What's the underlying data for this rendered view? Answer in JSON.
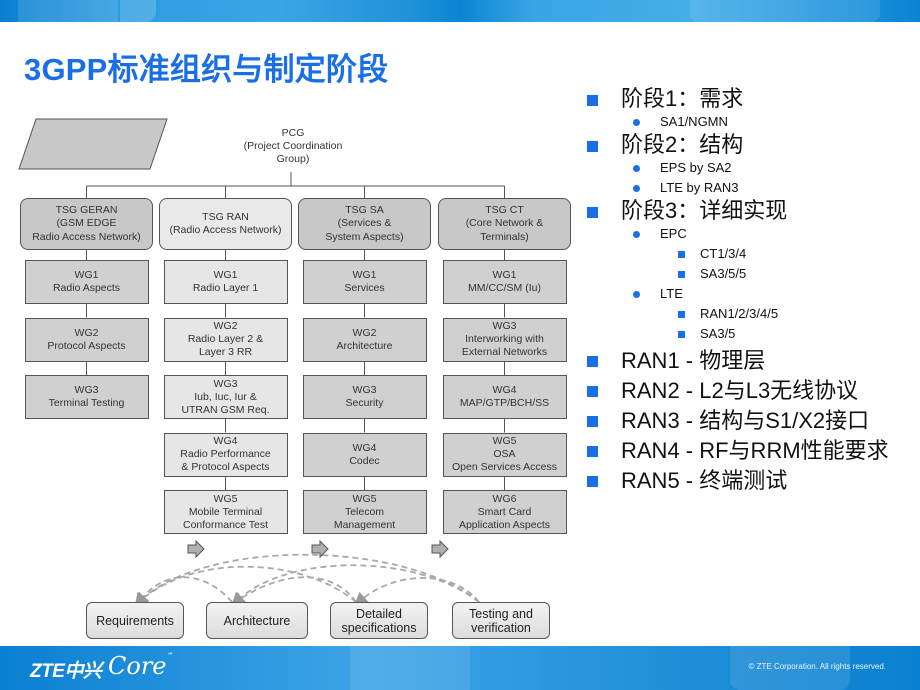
{
  "slide": {
    "title": "3GPP标准组织与制定阶段",
    "accent_color": "#1a6fe6"
  },
  "org_chart": {
    "root": {
      "lines": [
        "PCG",
        "(Project Coordination",
        "Group)"
      ]
    },
    "tsgs": [
      {
        "label": "TSG GERAN\n(GSM EDGE\nRadio Access Network)",
        "shade": "dark",
        "wgs": [
          "WG1\nRadio Aspects",
          "WG2\nProtocol Aspects",
          "WG3\nTerminal Testing"
        ]
      },
      {
        "label": "TSG RAN\n(Radio Access Network)",
        "shade": "light",
        "wgs": [
          "WG1\nRadio Layer 1",
          "WG2\nRadio Layer 2 &\nLayer 3 RR",
          "WG3\nIub, Iuc, Iur &\nUTRAN GSM Req.",
          "WG4\nRadio Performance\n& Protocol Aspects",
          "WG5\nMobile Terminal\nConformance Test"
        ]
      },
      {
        "label": "TSG SA\n(Services &\nSystem Aspects)",
        "shade": "dark",
        "wgs": [
          "WG1\nServices",
          "WG2\nArchitecture",
          "WG3\nSecurity",
          "WG4\nCodec",
          "WG5\nTelecom\nManagement"
        ]
      },
      {
        "label": "TSG CT\n(Core Network &\nTerminals)",
        "shade": "dark",
        "wgs": [
          "WG1\nMM/CC/SM (Iu)",
          "WG3\nInterworking with\nExternal Networks",
          "WG4\nMAP/GTP/BCH/SS",
          "WG5\nOSA\nOpen Services Access",
          "WG6\nSmart Card\nApplication Aspects"
        ]
      }
    ]
  },
  "process_flow": {
    "steps": [
      "Requirements",
      "Architecture",
      "Detailed\nspecifications",
      "Testing and\nverification"
    ]
  },
  "bullets": {
    "stages": [
      {
        "label": "阶段1：需求",
        "items": [
          {
            "label": "SA1/NGMN",
            "sub": []
          }
        ]
      },
      {
        "label": "阶段2：结构",
        "items": [
          {
            "label": "EPS by SA2",
            "sub": []
          },
          {
            "label": "LTE by RAN3",
            "sub": []
          }
        ]
      },
      {
        "label": "阶段3：详细实现",
        "items": [
          {
            "label": "EPC",
            "sub": [
              "CT1/3/4",
              "SA3/5/5"
            ]
          },
          {
            "label": "LTE",
            "sub": [
              "RAN1/2/3/4/5",
              "SA3/5"
            ]
          }
        ]
      }
    ],
    "ran_groups": [
      "RAN1 - 物理层",
      "RAN2 - L2与L3无线协议",
      "RAN3 - 结构与S1/X2接口",
      "RAN4 - RF与RRM性能要求",
      "RAN5 - 终端测试"
    ]
  },
  "footer": {
    "logo_zte": "ZTE中兴",
    "logo_core": "Core",
    "logo_core_mark": "℠",
    "copyright": "© ZTE Corporation. All rights reserved."
  }
}
